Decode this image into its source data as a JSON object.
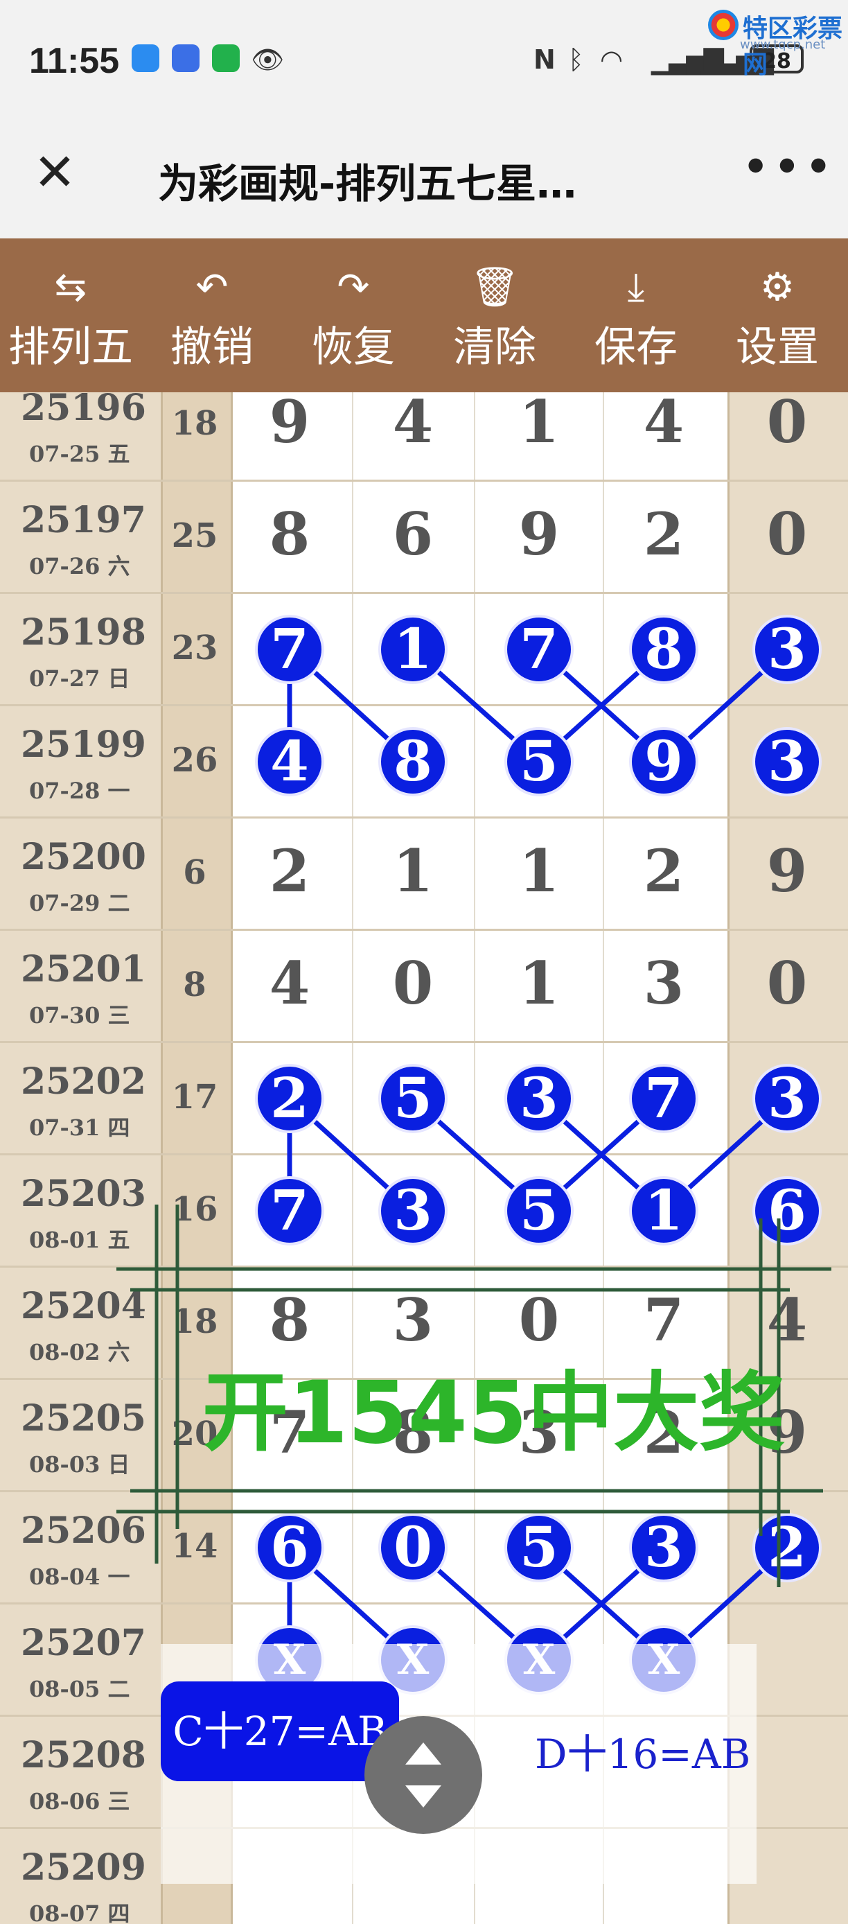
{
  "status_bar": {
    "time": "11:55",
    "battery": "28",
    "watermark_title": "特区彩票网",
    "watermark_url": "www.tqcp.net"
  },
  "title_bar": {
    "title": "为彩画规-排列五七星…",
    "close_icon": "close-icon",
    "more_icon": "more-dots-icon"
  },
  "toolbar": {
    "items": [
      {
        "icon": "swap-icon",
        "label": "排列五"
      },
      {
        "icon": "undo-icon",
        "label": "撤销"
      },
      {
        "icon": "redo-icon",
        "label": "恢复"
      },
      {
        "icon": "trash-icon",
        "label": "清除"
      },
      {
        "icon": "download-icon",
        "label": "保存"
      },
      {
        "icon": "gear-icon",
        "label": "设置"
      }
    ]
  },
  "rows": [
    {
      "issue": "25196",
      "date": "07-25 五",
      "sum": "18",
      "digits": [
        "9",
        "4",
        "1",
        "4",
        "0"
      ]
    },
    {
      "issue": "25197",
      "date": "07-26 六",
      "sum": "25",
      "digits": [
        "8",
        "6",
        "9",
        "2",
        "0"
      ]
    },
    {
      "issue": "25198",
      "date": "07-27 日",
      "sum": "23",
      "digits": [
        "7",
        "1",
        "7",
        "8",
        "3"
      ]
    },
    {
      "issue": "25199",
      "date": "07-28 一",
      "sum": "26",
      "digits": [
        "4",
        "8",
        "5",
        "9",
        "3"
      ]
    },
    {
      "issue": "25200",
      "date": "07-29 二",
      "sum": "6",
      "digits": [
        "2",
        "1",
        "1",
        "2",
        "9"
      ]
    },
    {
      "issue": "25201",
      "date": "07-30 三",
      "sum": "8",
      "digits": [
        "4",
        "0",
        "1",
        "3",
        "0"
      ]
    },
    {
      "issue": "25202",
      "date": "07-31 四",
      "sum": "17",
      "digits": [
        "2",
        "5",
        "3",
        "7",
        "3"
      ]
    },
    {
      "issue": "25203",
      "date": "08-01 五",
      "sum": "16",
      "digits": [
        "7",
        "3",
        "5",
        "1",
        "6"
      ]
    },
    {
      "issue": "25204",
      "date": "08-02 六",
      "sum": "18",
      "digits": [
        "8",
        "3",
        "0",
        "7",
        "4"
      ]
    },
    {
      "issue": "25205",
      "date": "08-03 日",
      "sum": "20",
      "digits": [
        "7",
        "8",
        "3",
        "2",
        "9"
      ]
    },
    {
      "issue": "25206",
      "date": "08-04 一",
      "sum": "14",
      "digits": [
        "6",
        "0",
        "5",
        "3",
        "2"
      ]
    },
    {
      "issue": "25207",
      "date": "08-05 二",
      "sum": "",
      "digits": [
        "X",
        "X",
        "X",
        "X",
        ""
      ]
    },
    {
      "issue": "25208",
      "date": "08-06 三",
      "sum": "",
      "digits": [
        "",
        "",
        "",
        "",
        ""
      ]
    },
    {
      "issue": "25209",
      "date": "08-07 四",
      "sum": "",
      "digits": [
        "",
        "",
        "",
        "",
        ""
      ]
    }
  ],
  "highlighted_rows": [
    2,
    3,
    6,
    7,
    10,
    11
  ],
  "ad_overlay": {
    "text": "开1545中大奖"
  },
  "notes": {
    "c_note": "C十27=AB",
    "d_note": "D十16=AB"
  },
  "colors": {
    "toolbar": "#9a6a48",
    "ball": "#0a1fe0",
    "ad_text": "#2db52a"
  }
}
